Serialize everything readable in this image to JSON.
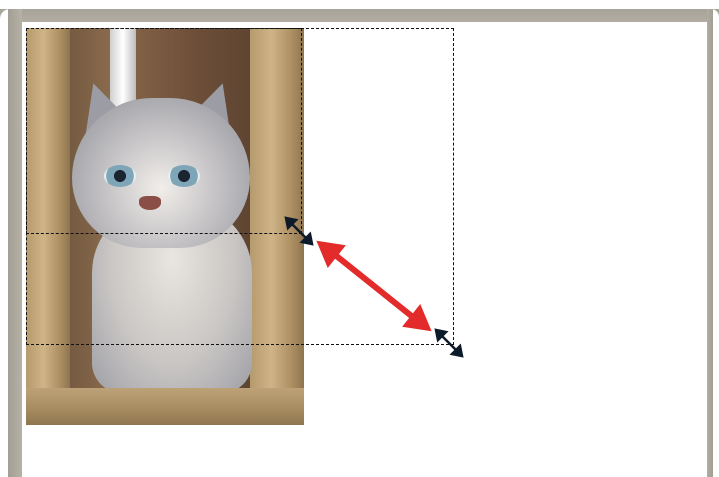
{
  "scene": {
    "description_tag": "image-crop-resize",
    "icons": {
      "small_handle": "diagonal-resize-cursor-icon",
      "large_handle": "diagonal-resize-cursor-icon",
      "arrow": "double-headed-arrow-icon"
    },
    "colors": {
      "frame": "#a7a398",
      "selection_border": "#111111",
      "arrow": "#e32b2b",
      "canvas": "#ffffff"
    }
  }
}
